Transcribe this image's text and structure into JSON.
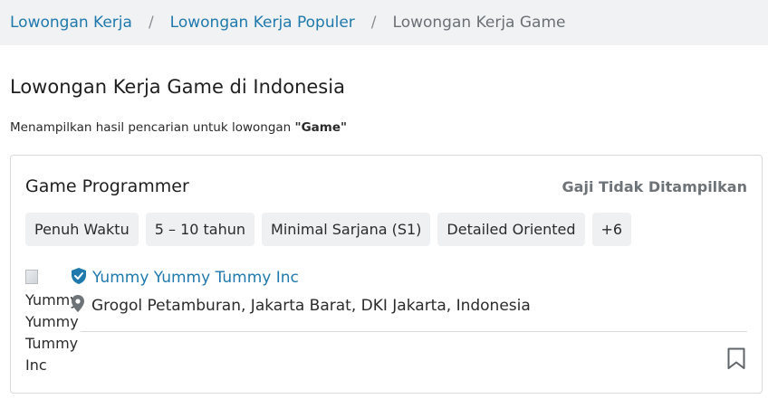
{
  "breadcrumb": {
    "items": [
      {
        "label": "Lowongan Kerja"
      },
      {
        "label": "Lowongan Kerja Populer"
      },
      {
        "label": "Lowongan Kerja Game"
      }
    ],
    "separator": "/"
  },
  "page": {
    "title": "Lowongan Kerja Game di Indonesia",
    "results_prefix": "Menampilkan hasil pencarian untuk lowongan ",
    "results_query": "\"Game\""
  },
  "job": {
    "title": "Game Programmer",
    "salary": "Gaji Tidak Ditampilkan",
    "tags": [
      "Penuh Waktu",
      "5 – 10 tahun",
      "Minimal Sarjana (S1)",
      "Detailed Oriented",
      "+6"
    ],
    "company": {
      "name": "Yummy Yummy Tummy Inc",
      "logo_alt_lines": [
        "Yummy",
        "Yummy",
        "Tummy",
        "Inc"
      ],
      "verified_icon": "verified-shield-icon"
    },
    "location": "Grogol Petamburan, Jakarta Barat, DKI Jakarta, Indonesia",
    "location_icon": "map-pin-icon",
    "bookmark_icon": "bookmark-icon"
  },
  "colors": {
    "link": "#1f79ad",
    "breadcrumb_bg": "#f1f2f3",
    "tag_bg": "#eef0f2",
    "muted": "#6e7378"
  }
}
